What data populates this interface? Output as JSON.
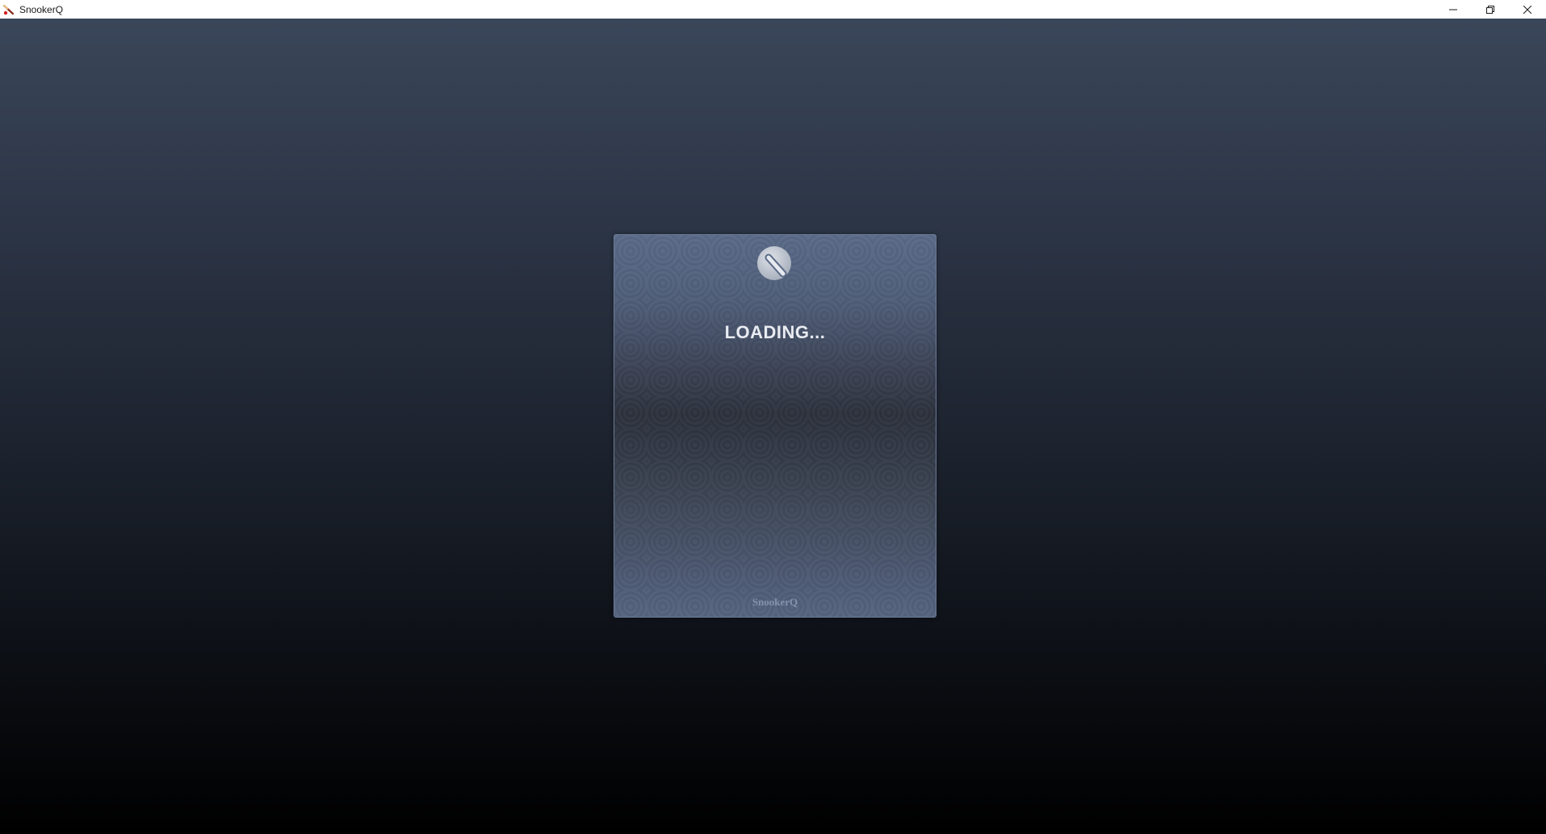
{
  "window": {
    "title": "SnookerQ",
    "app_icon": "snooker-cue-icon",
    "controls": {
      "minimize_icon": "minimize-icon",
      "restore_icon": "restore-icon",
      "close_icon": "close-icon"
    }
  },
  "loading_card": {
    "logo_icon": "snookerq-logo-icon",
    "status_text": "LOADING...",
    "footer_text": "SnookerQ"
  },
  "colors": {
    "titlebar_bg": "#ffffff",
    "background_top": "#3a4659",
    "background_bottom": "#000000",
    "card_top": "#5a6a88",
    "loading_text": "#e8ebf0",
    "footer_text": "#8492ad"
  }
}
